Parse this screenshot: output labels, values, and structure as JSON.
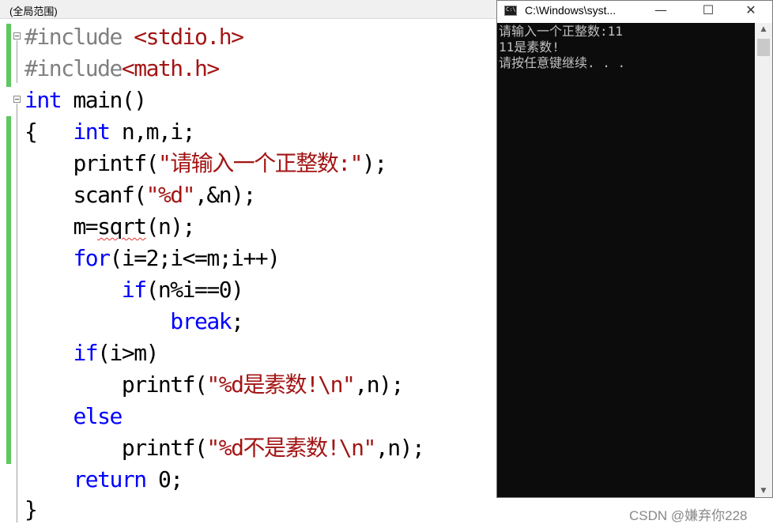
{
  "editor": {
    "scope_label": "(全局范围)",
    "lines": {
      "l1": {
        "directive": "#include",
        "header": " <stdio.h>"
      },
      "l2": {
        "directive": "#include",
        "header": "<math.h>"
      },
      "l3": {
        "kw": "int",
        "rest": " main()"
      },
      "l4": {
        "brace": "{",
        "kw": "int",
        "rest": " n,m,i;"
      },
      "l5": {
        "a": "printf(",
        "str": "\"请输入一个正整数:\"",
        "b": ");"
      },
      "l6": {
        "a": "scanf(",
        "str": "\"%d\"",
        "b": ",&n);"
      },
      "l7": {
        "a": "m=",
        "fn": "sqrt",
        "b": "(n);"
      },
      "l8": {
        "kw": "for",
        "rest": "(i=2;i<=m;i++)"
      },
      "l9": {
        "kw": "if",
        "rest": "(n%i==0)"
      },
      "l10": {
        "kw": "break",
        "rest": ";"
      },
      "l11": {
        "kw": "if",
        "rest": "(i>m)"
      },
      "l12": {
        "a": "printf(",
        "str": "\"%d是素数!\\n\"",
        "b": ",n);"
      },
      "l13": {
        "kw": "else"
      },
      "l14": {
        "a": "printf(",
        "str": "\"%d不是素数!\\n\"",
        "b": ",n);"
      },
      "l15": {
        "kw": "return",
        "rest": " 0;"
      },
      "l16": {
        "brace": "}"
      }
    }
  },
  "console": {
    "title": "C:\\Windows\\syst...",
    "minimize": "—",
    "maximize": "☐",
    "close": "✕",
    "output": [
      "请输入一个正整数:11",
      "11是素数!",
      "请按任意键继续. . ."
    ]
  },
  "watermark": "CSDN @嫌弃你228"
}
